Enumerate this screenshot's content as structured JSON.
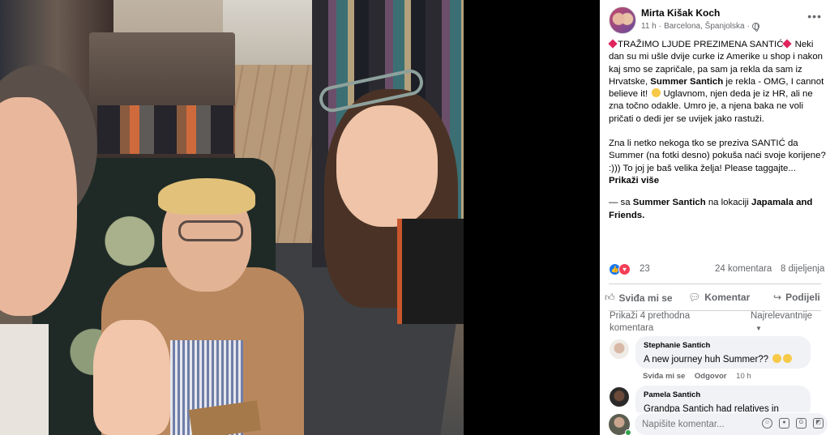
{
  "post": {
    "author": "Mirta Kišak Koch",
    "time": "11 h",
    "location": "Barcelona, Španjolska",
    "text1_a": "TRAŽIMO LJUDE PREZIMENA SANTIĆ",
    "text1_b": " Neki dan su mi ušle dvije curke iz Amerike u shop i nakon kaj smo se zapričale, pa sam ja rekla da sam iz Hrvatske, ",
    "text1_name": "Summer Santich",
    "text1_c": " je rekla - OMG, I cannot believe it! ",
    "text1_d": " Uglavnom, njen deda je iz HR, ali ne zna točno odakle. Umro je, a njena baka ne voli pričati o dedi jer se uvijek jako rastuži.",
    "text2_a": "Zna li netko nekoga tko se preziva SANTIĆ da Summer (na fotki desno) pokuša naći svoje korijene? :))) To joj je baš velika želja! Please taggajte...",
    "see_more": "Prikaži više",
    "tag_prefix": "— sa ",
    "tag_person": "Summer Santich",
    "tag_mid": " na lokaciji ",
    "tag_place": "Japamala and Friends."
  },
  "stats": {
    "reactions": "23",
    "comments": "24 komentara",
    "shares": "8 dijeljenja"
  },
  "actions": {
    "like": "Sviđa mi se",
    "comment": "Komentar",
    "share": "Podijeli"
  },
  "comments": {
    "previous": "Prikaži 4 prethodna komentara",
    "sort": "Najrelevantnije",
    "items": [
      {
        "name": "Stephanie Santich",
        "text": "A new journey huh Summer??",
        "like": "Sviđa mi se",
        "reply": "Odgovor",
        "time": "10 h"
      },
      {
        "name": "Pamela Santich",
        "text": "Grandpa Santich had relatives in"
      }
    ],
    "composer_placeholder": "Napišite komentar..."
  },
  "colors": {
    "link": "#050505",
    "like_blue": "#1877f2",
    "love_red": "#f33e58",
    "muted": "#65676b"
  }
}
